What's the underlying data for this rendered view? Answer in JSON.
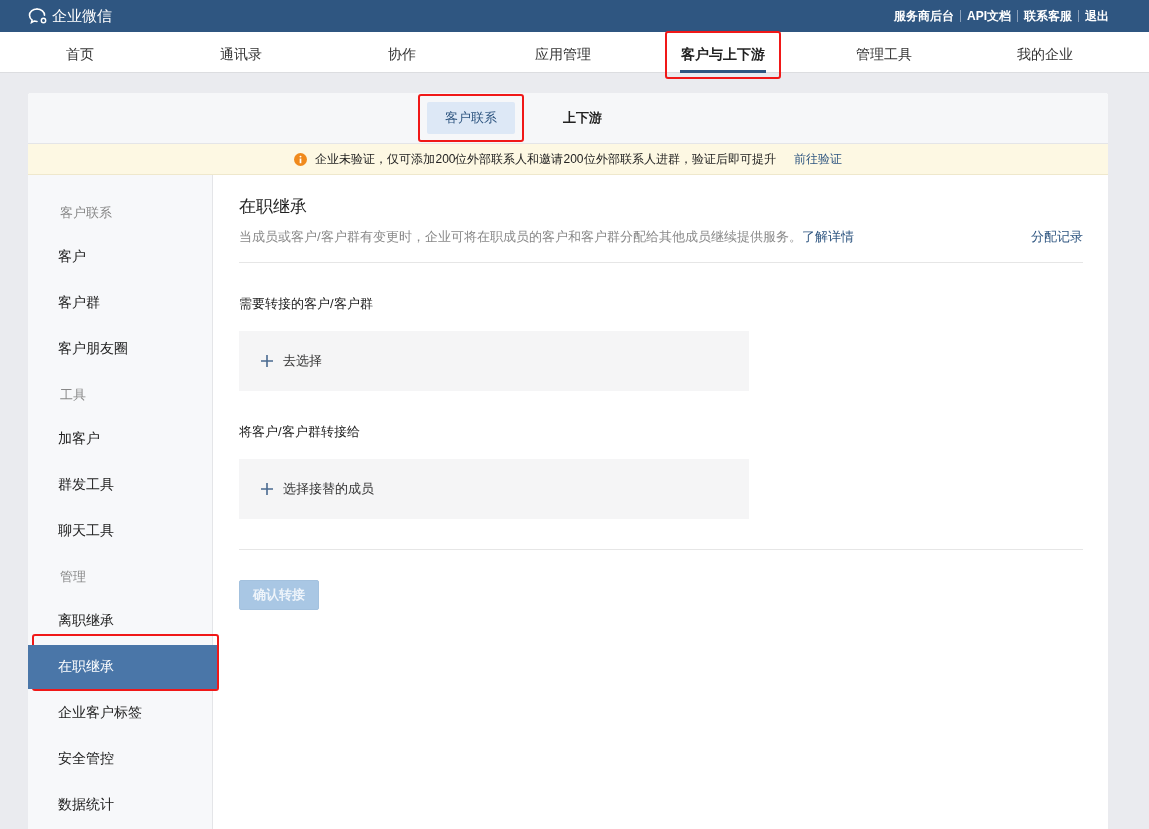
{
  "topbar": {
    "logo": "企业微信",
    "links": [
      "服务商后台",
      "API文档",
      "联系客服",
      "退出"
    ]
  },
  "nav": [
    {
      "label": "首页",
      "selected": false,
      "highlighted": false
    },
    {
      "label": "通讯录",
      "selected": false,
      "highlighted": false
    },
    {
      "label": "协作",
      "selected": false,
      "highlighted": false
    },
    {
      "label": "应用管理",
      "selected": false,
      "highlighted": false
    },
    {
      "label": "客户与上下游",
      "selected": true,
      "highlighted": true
    },
    {
      "label": "管理工具",
      "selected": false,
      "highlighted": false
    },
    {
      "label": "我的企业",
      "selected": false,
      "highlighted": false
    }
  ],
  "subtabs": [
    {
      "label": "客户联系",
      "selected": true,
      "highlighted": true
    },
    {
      "label": "上下游",
      "selected": false,
      "highlighted": false
    }
  ],
  "notice": {
    "text": "企业未验证，仅可添加200位外部联系人和邀请200位外部联系人进群，验证后即可提升",
    "link": "前往验证"
  },
  "sidebar": [
    {
      "title": "客户联系",
      "items": [
        {
          "label": "客户",
          "selected": false,
          "highlighted": false
        },
        {
          "label": "客户群",
          "selected": false,
          "highlighted": false
        },
        {
          "label": "客户朋友圈",
          "selected": false,
          "highlighted": false
        }
      ]
    },
    {
      "title": "工具",
      "items": [
        {
          "label": "加客户",
          "selected": false,
          "highlighted": false
        },
        {
          "label": "群发工具",
          "selected": false,
          "highlighted": false
        },
        {
          "label": "聊天工具",
          "selected": false,
          "highlighted": false
        }
      ]
    },
    {
      "title": "管理",
      "items": [
        {
          "label": "离职继承",
          "selected": false,
          "highlighted": false
        },
        {
          "label": "在职继承",
          "selected": true,
          "highlighted": true
        },
        {
          "label": "企业客户标签",
          "selected": false,
          "highlighted": false
        },
        {
          "label": "安全管控",
          "selected": false,
          "highlighted": false
        },
        {
          "label": "数据统计",
          "selected": false,
          "highlighted": false
        }
      ]
    }
  ],
  "content": {
    "title": "在职继承",
    "description": "当成员或客户/客户群有变更时，企业可将在职成员的客户和客户群分配给其他成员继续提供服务。",
    "details_link": "了解详情",
    "record_link": "分配记录",
    "sections": [
      {
        "label": "需要转接的客户/客户群",
        "picker": "去选择"
      },
      {
        "label": "将客户/客户群转接给",
        "picker": "选择接替的成员"
      }
    ],
    "confirm": {
      "label": "确认转接",
      "disabled": true
    }
  }
}
